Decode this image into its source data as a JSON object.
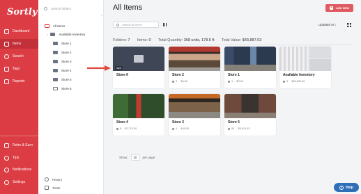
{
  "app": {
    "logo": "Sortly"
  },
  "nav": {
    "items": [
      {
        "label": "Dashboard",
        "icon": "dashboard-icon"
      },
      {
        "label": "Items",
        "icon": "items-icon",
        "active": true
      },
      {
        "label": "Search",
        "icon": "search-icon"
      },
      {
        "label": "Tags",
        "icon": "tag-icon"
      },
      {
        "label": "Reports",
        "icon": "reports-icon"
      }
    ],
    "bottom": [
      {
        "label": "Refer & Earn",
        "icon": "gift-icon"
      },
      {
        "label": "Tips",
        "icon": "lightbulb-icon"
      },
      {
        "label": "Notifications",
        "icon": "bell-icon"
      },
      {
        "label": "Settings",
        "icon": "gear-icon"
      }
    ]
  },
  "folders": {
    "search_placeholder": "Search folders",
    "all_items": "All Items",
    "tree": [
      "Available Inventory",
      "Store 1",
      "Store 2",
      "Store 3",
      "Store 4",
      "Store 5",
      "Store 6"
    ],
    "history": "History",
    "trash": "Trash"
  },
  "main": {
    "title": "All Items",
    "add_button": "ADD NEW",
    "search_placeholder": "Search All Items",
    "sort_label": "Updated At ↓",
    "stats": {
      "folders_label": "Folders:",
      "folders": "7",
      "items_label": "Items:",
      "items": "0",
      "qty_label": "Total Quantity:",
      "qty": "368 units, 178.5 ft",
      "value_label": "Total Value:",
      "value": "$43,887.03"
    },
    "cards": [
      {
        "name": "Store 6",
        "badge": "NEW",
        "count": "",
        "price": ""
      },
      {
        "name": "Store 2",
        "count": "3",
        "price": "$6.00"
      },
      {
        "name": "Store 1",
        "count": "1",
        "price": "$9.00"
      },
      {
        "name": "Available Inventory",
        "count": "4",
        "price": "$32,090.00"
      },
      {
        "name": "Store 4",
        "count": "8",
        "price": "$2,713.00"
      },
      {
        "name": "Store 3",
        "count": "4",
        "price": "$49.00"
      },
      {
        "name": "Store 5",
        "count": "84",
        "price": "$9,419.03"
      }
    ],
    "pager": {
      "show_label": "Show:",
      "per_page_value": "20",
      "per_page_label": "per page"
    },
    "help_label": "Help"
  },
  "colors": {
    "brand_red": "#dc3c44",
    "help_blue": "#2f6fb7",
    "arrow_red": "#e0493d"
  }
}
